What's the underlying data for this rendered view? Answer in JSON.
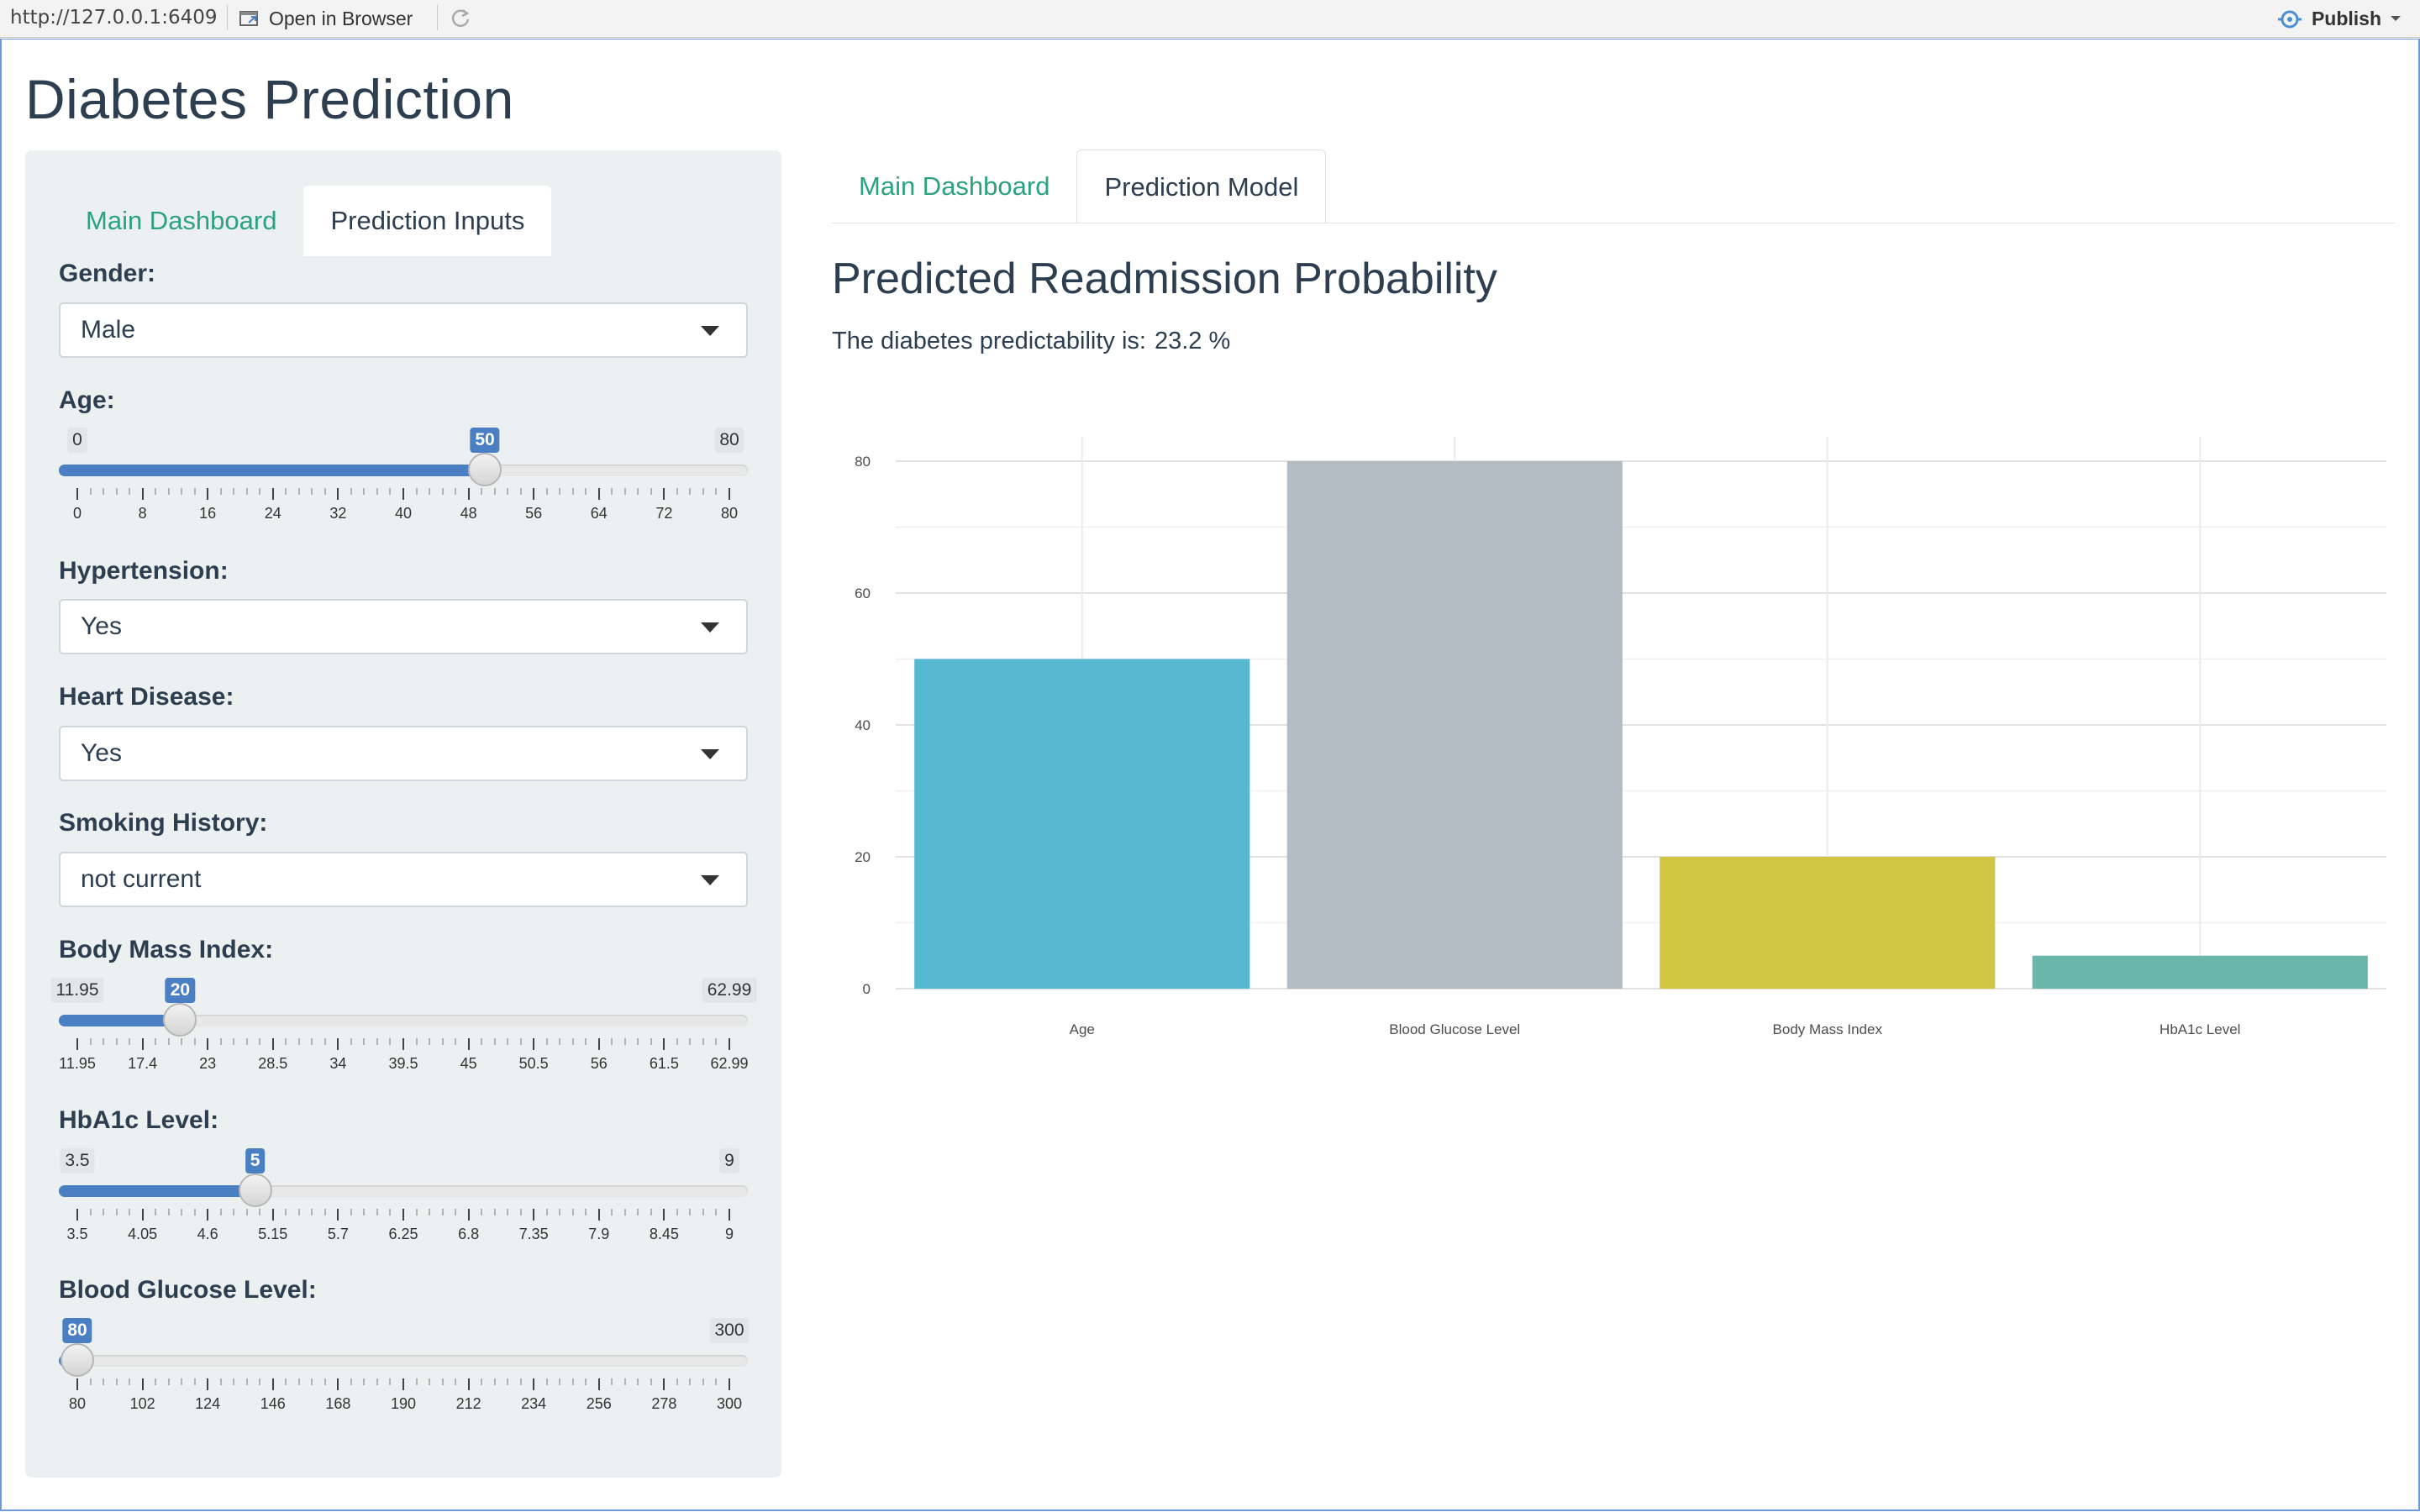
{
  "topbar": {
    "url": "http://127.0.0.1:6409",
    "open_in_browser": "Open in Browser",
    "publish": "Publish"
  },
  "app": {
    "title": "Diabetes Prediction"
  },
  "sidebar": {
    "tabs": [
      {
        "label": "Main Dashboard",
        "active": false
      },
      {
        "label": "Prediction Inputs",
        "active": true
      }
    ],
    "gender": {
      "label": "Gender:",
      "value": "Male"
    },
    "age": {
      "label": "Age:",
      "min": 0,
      "max": 80,
      "value": 50,
      "ticks": [
        "0",
        "8",
        "16",
        "24",
        "32",
        "40",
        "48",
        "56",
        "64",
        "72",
        "80"
      ]
    },
    "hypertension": {
      "label": "Hypertension:",
      "value": "Yes"
    },
    "heart_disease": {
      "label": "Heart Disease:",
      "value": "Yes"
    },
    "smoking_history": {
      "label": "Smoking History:",
      "value": "not current"
    },
    "bmi": {
      "label": "Body Mass Index:",
      "min": 11.95,
      "max": 62.99,
      "value": 20,
      "ticks": [
        "11.95",
        "17.4",
        "23",
        "28.5",
        "34",
        "39.5",
        "45",
        "50.5",
        "56",
        "61.5",
        "62.99"
      ]
    },
    "hba1c": {
      "label": "HbA1c Level:",
      "min": 3.5,
      "max": 9,
      "value": 5,
      "ticks": [
        "3.5",
        "4.05",
        "4.6",
        "5.15",
        "5.7",
        "6.25",
        "6.8",
        "7.35",
        "7.9",
        "8.45",
        "9"
      ]
    },
    "glucose": {
      "label": "Blood Glucose Level:",
      "min": 80,
      "max": 300,
      "value": 80,
      "ticks": [
        "80",
        "102",
        "124",
        "146",
        "168",
        "190",
        "212",
        "234",
        "256",
        "278",
        "300"
      ]
    }
  },
  "main": {
    "tabs": [
      {
        "label": "Main Dashboard",
        "active": false
      },
      {
        "label": "Prediction Model",
        "active": true
      }
    ],
    "title": "Predicted Readmission Probability",
    "prediction_prefix": "The diabetes predictability is:",
    "prediction_value": "23.2 %"
  },
  "chart_data": {
    "type": "bar",
    "categories": [
      "Age",
      "Blood Glucose Level",
      "Body Mass Index",
      "HbA1c Level"
    ],
    "values": [
      50,
      80,
      20,
      5
    ],
    "colors": [
      "#56b8d2",
      "#b3bcc3",
      "#d1c642",
      "#6ab6aa"
    ],
    "yticks": [
      0,
      20,
      40,
      60,
      80
    ],
    "ylim": [
      0,
      80
    ],
    "grid": true
  }
}
